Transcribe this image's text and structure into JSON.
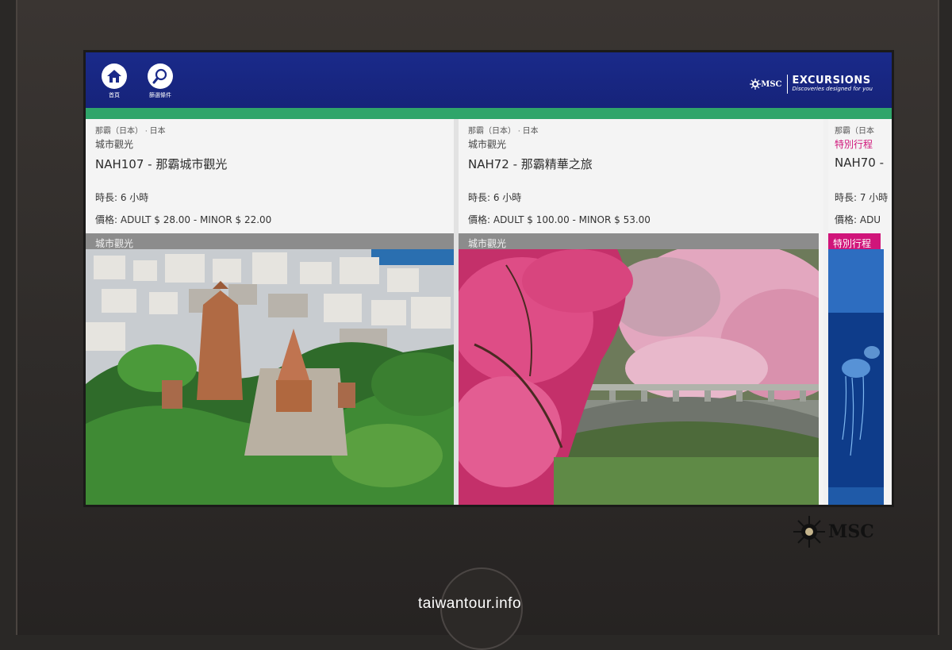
{
  "header": {
    "home_label": "首頁",
    "filter_label": "篩選條件",
    "brand_msc": "MSC",
    "brand_title": "EXCURSIONS",
    "brand_subtitle": "Discoveries designed for you"
  },
  "cards": [
    {
      "location": "那霸（日本）",
      "country": "日本",
      "category": "城市觀光",
      "title": "NAH107 - 那霸城市觀光",
      "duration": "時長: 6 小時",
      "price": "價格: ADULT $ 28.00 -  MINOR $ 22.00",
      "banner": "城市觀光"
    },
    {
      "location": "那霸（日本）",
      "country": "日本",
      "category": "城市觀光",
      "title": "NAH72 - 那霸精華之旅",
      "duration": "時長: 6 小時",
      "price": "價格: ADULT $ 100.00 -  MINOR $ 53.00",
      "banner": "城市觀光"
    },
    {
      "location": "那霸（日本",
      "category": "特別行程",
      "title": "NAH70 -",
      "duration": "時長: 7 小時",
      "price": "價格: ADU",
      "banner": "特別行程"
    }
  ],
  "kiosk": {
    "logo_text": "MSC",
    "watermark": "taiwantour.info"
  },
  "colors": {
    "header_bg": "#1a2a8a",
    "accent_stripe": "#2fa56a",
    "banner_gray": "#8c8c8c",
    "special_pink": "#d0157a"
  }
}
